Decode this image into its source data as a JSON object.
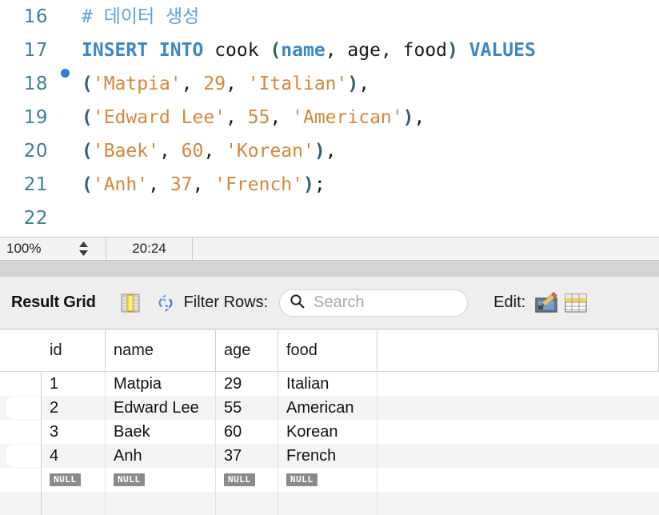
{
  "editor": {
    "lines": [
      {
        "number": "16",
        "breakpoint": false,
        "tokens": [
          {
            "cls": "tok-comment",
            "text": "# 데이터 생성"
          }
        ]
      },
      {
        "number": "17",
        "breakpoint": true,
        "tokens": [
          {
            "cls": "tok-kw",
            "text": "INSERT INTO"
          },
          {
            "cls": "tok-plain",
            "text": " "
          },
          {
            "cls": "tok-ident",
            "text": "cook"
          },
          {
            "cls": "tok-plain",
            "text": " "
          },
          {
            "cls": "tok-punct",
            "text": "("
          },
          {
            "cls": "tok-col",
            "text": "name"
          },
          {
            "cls": "tok-plain",
            "text": ", "
          },
          {
            "cls": "tok-ident",
            "text": "age"
          },
          {
            "cls": "tok-plain",
            "text": ", "
          },
          {
            "cls": "tok-ident",
            "text": "food"
          },
          {
            "cls": "tok-punct",
            "text": ")"
          },
          {
            "cls": "tok-plain",
            "text": " "
          },
          {
            "cls": "tok-kw",
            "text": "VALUES"
          }
        ]
      },
      {
        "number": "18",
        "breakpoint": false,
        "tokens": [
          {
            "cls": "tok-punct",
            "text": "("
          },
          {
            "cls": "tok-str",
            "text": "'Matpia'"
          },
          {
            "cls": "tok-plain",
            "text": ", "
          },
          {
            "cls": "tok-num",
            "text": "29"
          },
          {
            "cls": "tok-plain",
            "text": ", "
          },
          {
            "cls": "tok-str",
            "text": "'Italian'"
          },
          {
            "cls": "tok-punct",
            "text": ")"
          },
          {
            "cls": "tok-plain",
            "text": ","
          }
        ]
      },
      {
        "number": "19",
        "breakpoint": false,
        "tokens": [
          {
            "cls": "tok-punct",
            "text": "("
          },
          {
            "cls": "tok-str",
            "text": "'Edward Lee'"
          },
          {
            "cls": "tok-plain",
            "text": ", "
          },
          {
            "cls": "tok-num",
            "text": "55"
          },
          {
            "cls": "tok-plain",
            "text": ", "
          },
          {
            "cls": "tok-str",
            "text": "'American'"
          },
          {
            "cls": "tok-punct",
            "text": ")"
          },
          {
            "cls": "tok-plain",
            "text": ","
          }
        ]
      },
      {
        "number": "20",
        "breakpoint": false,
        "tokens": [
          {
            "cls": "tok-punct",
            "text": "("
          },
          {
            "cls": "tok-str",
            "text": "'Baek'"
          },
          {
            "cls": "tok-plain",
            "text": ", "
          },
          {
            "cls": "tok-num",
            "text": "60"
          },
          {
            "cls": "tok-plain",
            "text": ", "
          },
          {
            "cls": "tok-str",
            "text": "'Korean'"
          },
          {
            "cls": "tok-punct",
            "text": ")"
          },
          {
            "cls": "tok-plain",
            "text": ","
          }
        ]
      },
      {
        "number": "21",
        "breakpoint": false,
        "tokens": [
          {
            "cls": "tok-punct",
            "text": "("
          },
          {
            "cls": "tok-str",
            "text": "'Anh'"
          },
          {
            "cls": "tok-plain",
            "text": ", "
          },
          {
            "cls": "tok-num",
            "text": "37"
          },
          {
            "cls": "tok-plain",
            "text": ", "
          },
          {
            "cls": "tok-str",
            "text": "'French'"
          },
          {
            "cls": "tok-punct",
            "text": ")"
          },
          {
            "cls": "tok-plain",
            "text": ";"
          }
        ]
      },
      {
        "number": "22",
        "breakpoint": false,
        "tokens": []
      }
    ]
  },
  "statusbar": {
    "zoom_value": "100%",
    "stepper_icon": "stepper-up-down-icon",
    "cursor_position": "20:24"
  },
  "result_toolbar": {
    "title": "Result Grid",
    "grid_view_icon": "grid-columns-icon",
    "refresh_icon": "refresh-icon",
    "filter_label": "Filter Rows:",
    "search": {
      "icon": "search-icon",
      "value": "",
      "placeholder": "Search"
    },
    "edit_label": "Edit:",
    "edit_icon": "pencil-edit-icon",
    "table_icon": "table-grid-icon"
  },
  "result_grid": {
    "columns": [
      "id",
      "name",
      "age",
      "food"
    ],
    "rows": [
      {
        "id": "1",
        "name": "Matpia",
        "age": "29",
        "food": "Italian"
      },
      {
        "id": "2",
        "name": "Edward Lee",
        "age": "55",
        "food": "American"
      },
      {
        "id": "3",
        "name": "Baek",
        "age": "60",
        "food": "Korean"
      },
      {
        "id": "4",
        "name": "Anh",
        "age": "37",
        "food": "French"
      }
    ],
    "null_label": "NULL"
  },
  "colors": {
    "keyword": "#3b87c8",
    "string": "#d4883a",
    "comment": "#5ba3da",
    "line_number": "#3f7e94",
    "breakpoint": "#2d7fd3",
    "toolbar_bg": "#eeeeee",
    "row_stripe": "#f4f4f4",
    "null_badge_bg": "#8a8a8a"
  }
}
